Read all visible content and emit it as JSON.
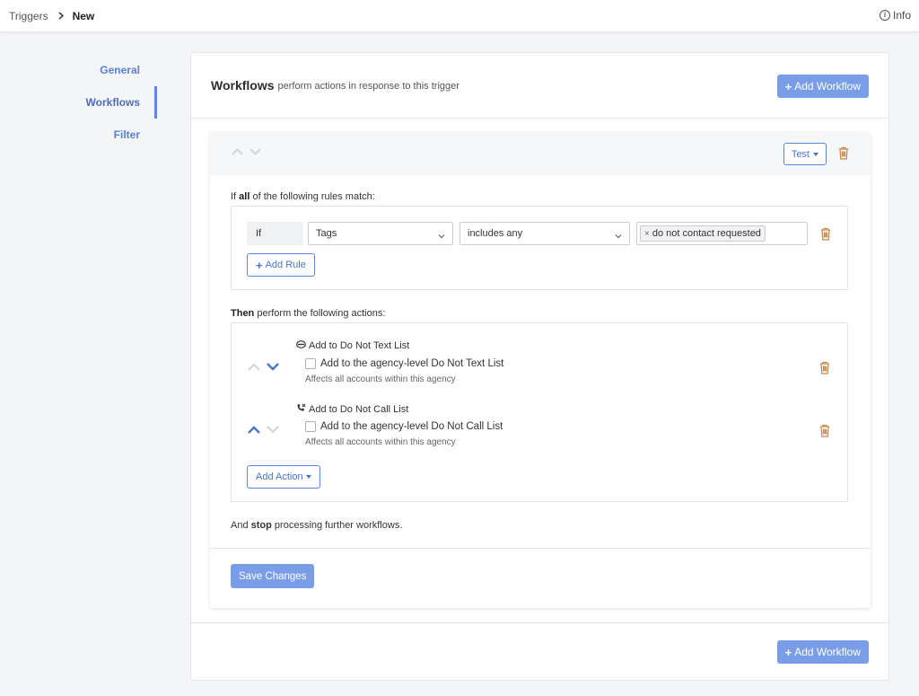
{
  "breadcrumb": {
    "parent": "Triggers",
    "current": "New"
  },
  "info_label": "Info",
  "sidenav": {
    "items": [
      {
        "label": "General",
        "active": false
      },
      {
        "label": "Workflows",
        "active": true
      },
      {
        "label": "Filter",
        "active": false
      }
    ]
  },
  "header": {
    "title": "Workflows",
    "subtitle": "perform actions in response to this trigger",
    "add_workflow_label": "Add Workflow"
  },
  "workflow": {
    "test_label": "Test",
    "rules_intro_prefix": "If ",
    "rules_intro_bold": "all",
    "rules_intro_suffix": " of the following rules match:",
    "rule": {
      "if_label": "If",
      "field": "Tags",
      "operator": "includes any",
      "tag": "do not contact requested"
    },
    "add_rule_label": "Add Rule",
    "actions_intro_bold": "Then",
    "actions_intro_suffix": " perform the following actions:",
    "actions": [
      {
        "title": "Add to Do Not Text List",
        "checkbox_label": "Add to the agency-level Do Not Text List",
        "help": "Affects all accounts within this agency"
      },
      {
        "title": "Add to Do Not Call List",
        "checkbox_label": "Add to the agency-level Do Not Call List",
        "help": "Affects all accounts within this agency"
      }
    ],
    "add_action_label": "Add Action",
    "stop_prefix": "And ",
    "stop_bold": "stop",
    "stop_suffix": " processing further workflows.",
    "save_label": "Save Changes"
  },
  "colors": {
    "accent": "#7a9de8",
    "link": "#5a7fcf",
    "danger_icon": "#c98a4a",
    "arrow_active": "#4a74c9",
    "arrow_inactive": "#d0d4da"
  }
}
